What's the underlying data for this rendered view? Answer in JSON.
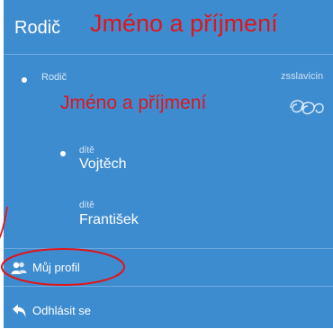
{
  "header": {
    "title": "Rodič",
    "annotation": "Jméno a příjmení"
  },
  "account": {
    "role_label": "Rodič",
    "name_annotation": "Jméno a příjmení",
    "school": "zsslavicin",
    "logo_icon": "school-logo-icon"
  },
  "children": [
    {
      "label": "dítě",
      "name": "Vojtěch",
      "selected": true
    },
    {
      "label": "dítě",
      "name": "František",
      "selected": false
    }
  ],
  "menu": [
    {
      "label": "Můj profil",
      "icon": "users-icon"
    },
    {
      "label": "Odhlásit se",
      "icon": "back-arrow-icon"
    }
  ],
  "colors": {
    "panel": "#3e8cd0",
    "annotation": "#e0151b"
  }
}
